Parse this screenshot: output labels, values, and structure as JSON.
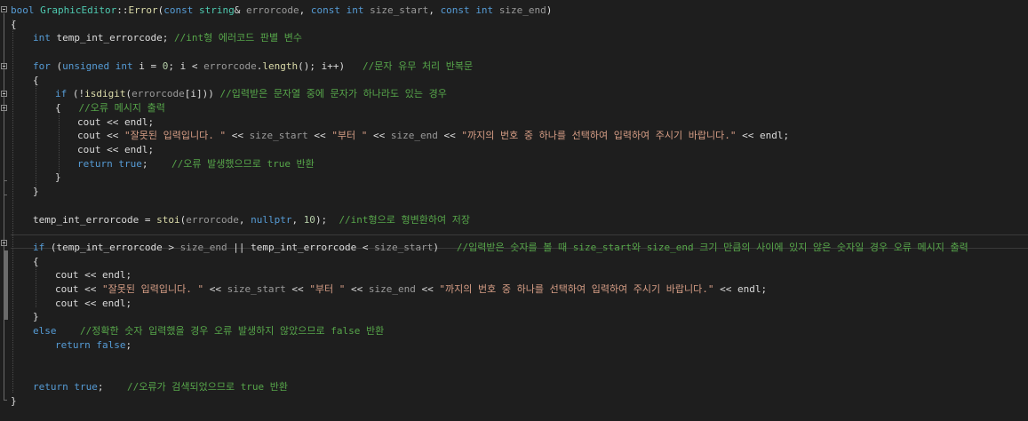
{
  "editor": {
    "language": "C++",
    "lines": [
      {
        "indent": 0,
        "tokens": [
          [
            "kw",
            "bool"
          ],
          [
            "tx",
            " "
          ],
          [
            "ty",
            "GraphicEditor"
          ],
          [
            "tx",
            "::"
          ],
          [
            "fn",
            "Error"
          ],
          [
            "tx",
            "("
          ],
          [
            "kw",
            "const"
          ],
          [
            "tx",
            " "
          ],
          [
            "ty",
            "string"
          ],
          [
            "tx",
            "& "
          ],
          [
            "pm",
            "errorcode"
          ],
          [
            "tx",
            ", "
          ],
          [
            "kw",
            "const"
          ],
          [
            "tx",
            " "
          ],
          [
            "kw",
            "int"
          ],
          [
            "tx",
            " "
          ],
          [
            "pm",
            "size_start"
          ],
          [
            "tx",
            ", "
          ],
          [
            "kw",
            "const"
          ],
          [
            "tx",
            " "
          ],
          [
            "kw",
            "int"
          ],
          [
            "tx",
            " "
          ],
          [
            "pm",
            "size_end"
          ],
          [
            "tx",
            ")"
          ]
        ]
      },
      {
        "indent": 0,
        "tokens": [
          [
            "tx",
            "{"
          ]
        ]
      },
      {
        "indent": 1,
        "tokens": [
          [
            "kw",
            "int"
          ],
          [
            "tx",
            " "
          ],
          [
            "vr",
            "temp_int_errorcode"
          ],
          [
            "tx",
            "; "
          ],
          [
            "cm",
            "//int형 에러코드 판별 변수"
          ]
        ]
      },
      {
        "indent": 0,
        "tokens": []
      },
      {
        "indent": 1,
        "tokens": [
          [
            "kw",
            "for"
          ],
          [
            "tx",
            " ("
          ],
          [
            "kw",
            "unsigned"
          ],
          [
            "tx",
            " "
          ],
          [
            "kw",
            "int"
          ],
          [
            "tx",
            " "
          ],
          [
            "vr",
            "i"
          ],
          [
            "tx",
            " = "
          ],
          [
            "nu",
            "0"
          ],
          [
            "tx",
            "; "
          ],
          [
            "vr",
            "i"
          ],
          [
            "tx",
            " < "
          ],
          [
            "pm",
            "errorcode"
          ],
          [
            "tx",
            "."
          ],
          [
            "fn",
            "length"
          ],
          [
            "tx",
            "(); "
          ],
          [
            "vr",
            "i"
          ],
          [
            "tx",
            "++)   "
          ],
          [
            "cm",
            "//문자 유무 처리 반복문"
          ]
        ]
      },
      {
        "indent": 1,
        "tokens": [
          [
            "tx",
            "{"
          ]
        ]
      },
      {
        "indent": 2,
        "tokens": [
          [
            "kw",
            "if"
          ],
          [
            "tx",
            " (!"
          ],
          [
            "fn",
            "isdigit"
          ],
          [
            "tx",
            "("
          ],
          [
            "pm",
            "errorcode"
          ],
          [
            "tx",
            "["
          ],
          [
            "vr",
            "i"
          ],
          [
            "tx",
            "])) "
          ],
          [
            "cm",
            "//입력받은 문자열 중에 문자가 하나라도 있는 경우"
          ]
        ]
      },
      {
        "indent": 2,
        "tokens": [
          [
            "tx",
            "{   "
          ],
          [
            "cm",
            "//오류 메시지 출력"
          ]
        ]
      },
      {
        "indent": 3,
        "tokens": [
          [
            "vr",
            "cout"
          ],
          [
            "tx",
            " << "
          ],
          [
            "vr",
            "endl"
          ],
          [
            "tx",
            ";"
          ]
        ]
      },
      {
        "indent": 3,
        "tokens": [
          [
            "vr",
            "cout"
          ],
          [
            "tx",
            " << "
          ],
          [
            "st",
            "\"잘못된 입력입니다. \""
          ],
          [
            "tx",
            " << "
          ],
          [
            "pm",
            "size_start"
          ],
          [
            "tx",
            " << "
          ],
          [
            "st",
            "\"부터 \""
          ],
          [
            "tx",
            " << "
          ],
          [
            "pm",
            "size_end"
          ],
          [
            "tx",
            " << "
          ],
          [
            "st",
            "\"까지의 번호 중 하나를 선택하여 입력하여 주시기 바랍니다.\""
          ],
          [
            "tx",
            " << "
          ],
          [
            "vr",
            "endl"
          ],
          [
            "tx",
            ";"
          ]
        ]
      },
      {
        "indent": 3,
        "tokens": [
          [
            "vr",
            "cout"
          ],
          [
            "tx",
            " << "
          ],
          [
            "vr",
            "endl"
          ],
          [
            "tx",
            ";"
          ]
        ]
      },
      {
        "indent": 3,
        "tokens": [
          [
            "kw",
            "return"
          ],
          [
            "tx",
            " "
          ],
          [
            "kw",
            "true"
          ],
          [
            "tx",
            ";    "
          ],
          [
            "cm",
            "//오류 발생했으므로 true 반환"
          ]
        ]
      },
      {
        "indent": 2,
        "tokens": [
          [
            "tx",
            "}"
          ]
        ]
      },
      {
        "indent": 1,
        "tokens": [
          [
            "tx",
            "}"
          ]
        ]
      },
      {
        "indent": 0,
        "tokens": []
      },
      {
        "indent": 1,
        "tokens": [
          [
            "vr",
            "temp_int_errorcode"
          ],
          [
            "tx",
            " = "
          ],
          [
            "fn",
            "stoi"
          ],
          [
            "tx",
            "("
          ],
          [
            "pm",
            "errorcode"
          ],
          [
            "tx",
            ", "
          ],
          [
            "kw",
            "nullptr"
          ],
          [
            "tx",
            ", "
          ],
          [
            "nu",
            "10"
          ],
          [
            "tx",
            ");  "
          ],
          [
            "cm",
            "//int형으로 형변환하여 저장"
          ]
        ]
      },
      {
        "indent": 0,
        "tokens": []
      },
      {
        "indent": 1,
        "tokens": [
          [
            "kw",
            "if"
          ],
          [
            "tx",
            " ("
          ],
          [
            "vr",
            "temp_int_errorcode"
          ],
          [
            "tx",
            " > "
          ],
          [
            "pm",
            "size_end"
          ],
          [
            "tx",
            " || "
          ],
          [
            "vr",
            "temp_int_errorcode"
          ],
          [
            "tx",
            " < "
          ],
          [
            "pm",
            "size_start"
          ],
          [
            "tx",
            ")   "
          ],
          [
            "cm",
            "//입력받은 숫자를 볼 때 size_start와 size_end 크기 만큼의 사이에 있지 않은 숫자일 경우 오류 메시지 출력"
          ]
        ]
      },
      {
        "indent": 1,
        "tokens": [
          [
            "tx",
            "{"
          ]
        ]
      },
      {
        "indent": 2,
        "tokens": [
          [
            "vr",
            "cout"
          ],
          [
            "tx",
            " << "
          ],
          [
            "vr",
            "endl"
          ],
          [
            "tx",
            ";"
          ]
        ]
      },
      {
        "indent": 2,
        "tokens": [
          [
            "vr",
            "cout"
          ],
          [
            "tx",
            " << "
          ],
          [
            "st",
            "\"잘못된 입력입니다. \""
          ],
          [
            "tx",
            " << "
          ],
          [
            "pm",
            "size_start"
          ],
          [
            "tx",
            " << "
          ],
          [
            "st",
            "\"부터 \""
          ],
          [
            "tx",
            " << "
          ],
          [
            "pm",
            "size_end"
          ],
          [
            "tx",
            " << "
          ],
          [
            "st",
            "\"까지의 번호 중 하나를 선택하여 입력하여 주시기 바랍니다.\""
          ],
          [
            "tx",
            " << "
          ],
          [
            "vr",
            "endl"
          ],
          [
            "tx",
            ";"
          ]
        ]
      },
      {
        "indent": 2,
        "tokens": [
          [
            "vr",
            "cout"
          ],
          [
            "tx",
            " << "
          ],
          [
            "vr",
            "endl"
          ],
          [
            "tx",
            ";"
          ]
        ]
      },
      {
        "indent": 1,
        "tokens": [
          [
            "tx",
            "}"
          ]
        ]
      },
      {
        "indent": 1,
        "tokens": [
          [
            "kw",
            "else"
          ],
          [
            "tx",
            "    "
          ],
          [
            "cm",
            "//정확한 숫자 입력했을 경우 오류 발생하지 않았으므로 false 반환"
          ]
        ]
      },
      {
        "indent": 2,
        "tokens": [
          [
            "kw",
            "return"
          ],
          [
            "tx",
            " "
          ],
          [
            "kw",
            "false"
          ],
          [
            "tx",
            ";"
          ]
        ]
      },
      {
        "indent": 0,
        "tokens": []
      },
      {
        "indent": 0,
        "tokens": []
      },
      {
        "indent": 1,
        "tokens": [
          [
            "kw",
            "return"
          ],
          [
            "tx",
            " "
          ],
          [
            "kw",
            "true"
          ],
          [
            "tx",
            ";    "
          ],
          [
            "cm",
            "//오류가 검색되었으므로 true 반환"
          ]
        ]
      },
      {
        "indent": 0,
        "tokens": [
          [
            "tx",
            "}"
          ]
        ]
      }
    ]
  }
}
